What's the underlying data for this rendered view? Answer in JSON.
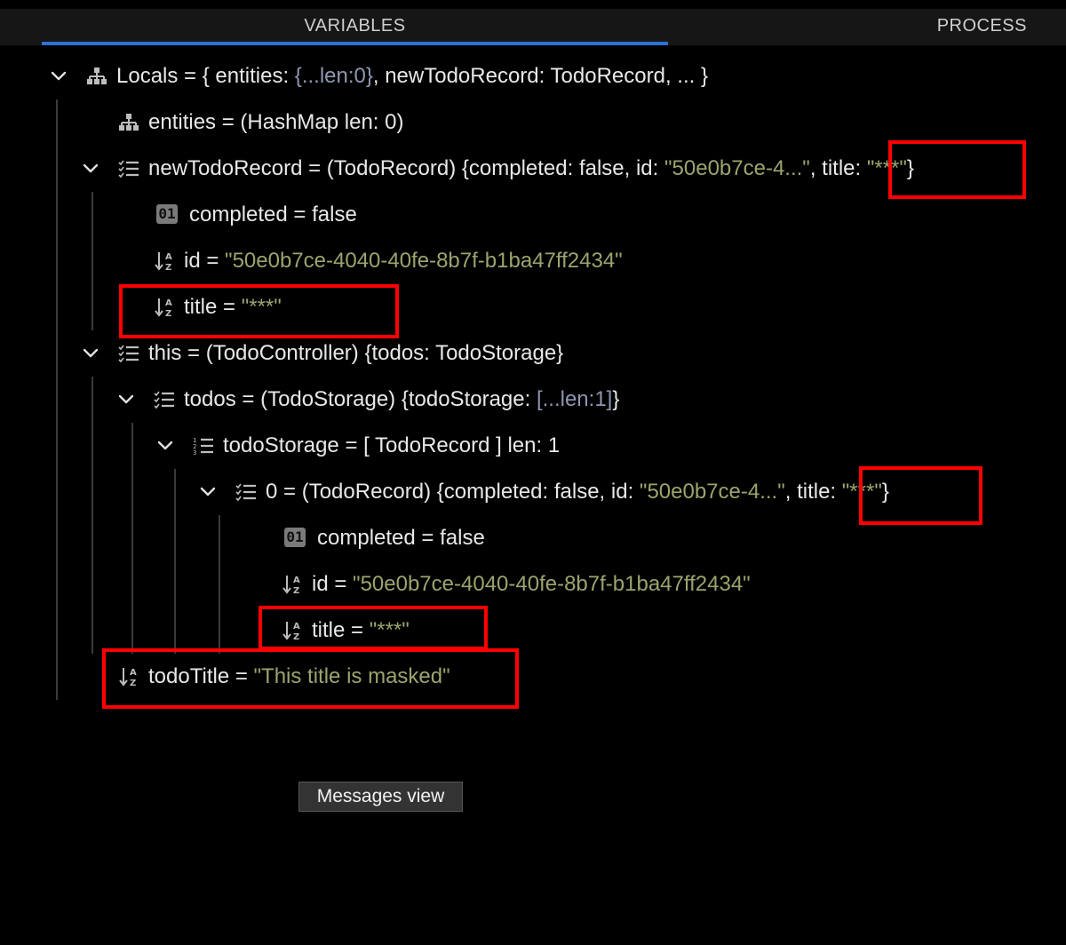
{
  "tabs": {
    "variables": "VARIABLES",
    "process": "PROCESS"
  },
  "tree": {
    "locals": {
      "name": "Locals",
      "eq": " = ",
      "open": "{ entities: ",
      "entities_preview": "{...len:0}",
      "rest": ", newTodoRecord: TodoRecord, ... }"
    },
    "entities": {
      "name": "entities",
      "eq": " = ",
      "value": "(HashMap len: 0)"
    },
    "newTodoRecord": {
      "name": "newTodoRecord",
      "eq": " = ",
      "prefix": "(TodoRecord) {completed: false, id: ",
      "id_preview": "\"50e0b7ce-4...\"",
      "mid": ", title: ",
      "title_preview": "\"***\"",
      "close": "}"
    },
    "completed1": {
      "name": "completed",
      "eq": " = ",
      "value": "false"
    },
    "id1": {
      "name": "id",
      "eq": " = ",
      "value": "\"50e0b7ce-4040-40fe-8b7f-b1ba47ff2434\""
    },
    "title1": {
      "name": "title",
      "eq": " = ",
      "value": "\"***\""
    },
    "this": {
      "name": "this",
      "eq": " = ",
      "value": "(TodoController) {todos: TodoStorage}"
    },
    "todos": {
      "name": "todos",
      "eq": " = ",
      "prefix": "(TodoStorage) {todoStorage: ",
      "preview": "[...len:1]",
      "close": "}"
    },
    "todoStorage": {
      "name": "todoStorage",
      "eq": " = ",
      "value": "[ TodoRecord ] len: 1"
    },
    "item0": {
      "name": "0",
      "eq": " = ",
      "prefix": "(TodoRecord) {completed: false, id: ",
      "id_preview": "\"50e0b7ce-4...\"",
      "mid": ", title: ",
      "title_preview": "\"***\"",
      "close": "}"
    },
    "completed2": {
      "name": "completed",
      "eq": " = ",
      "value": "false"
    },
    "id2": {
      "name": "id",
      "eq": " = ",
      "value": "\"50e0b7ce-4040-40fe-8b7f-b1ba47ff2434\""
    },
    "title2": {
      "name": "title",
      "eq": " = ",
      "value": "\"***\""
    },
    "todoTitle": {
      "name": "todoTitle",
      "eq": " = ",
      "value": "\"This title is masked\""
    }
  },
  "badge_label": "01",
  "messages_button": "Messages view",
  "colors": {
    "string": "#9aa56d",
    "highlight": "#ff0000",
    "accent": "#2f6fd8"
  },
  "icons": {
    "locals": "hierarchy-icon",
    "object": "checklist-icon",
    "array": "numbered-list-icon",
    "string": "sort-az-icon",
    "boolean": "binary-01-icon"
  }
}
